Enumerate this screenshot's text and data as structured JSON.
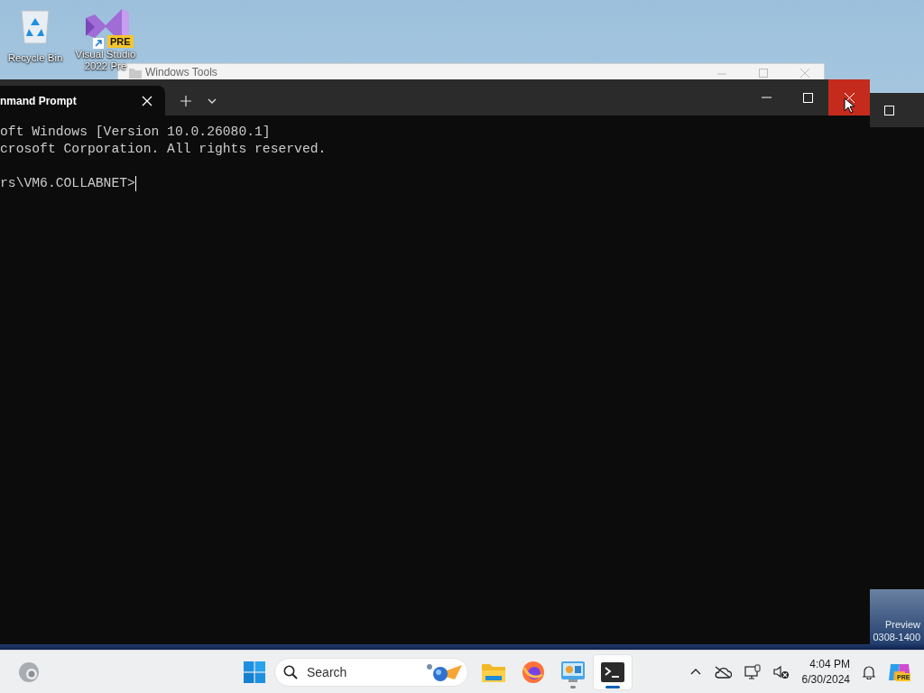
{
  "desktop_icons": [
    {
      "kind": "recycle",
      "label": "Recycle Bin"
    },
    {
      "kind": "vs",
      "label": "Visual Studio 2022 Pre",
      "badge": "PRE"
    }
  ],
  "background_window": {
    "title": "Windows Tools"
  },
  "terminal": {
    "tabs": [
      {
        "label": "nmand Prompt",
        "selected": true
      }
    ],
    "lines": [
      "oft Windows [Version 10.0.26080.1]",
      "crosoft Corporation. All rights reserved."
    ],
    "prompt": "rs\\VM6.COLLABNET>",
    "controls": [
      {
        "kind": "minimize",
        "hovered": false
      },
      {
        "kind": "maximize",
        "hovered": false
      },
      {
        "kind": "close",
        "hovered": true
      }
    ]
  },
  "desktop_watermark": [
    "Preview",
    "0308-1400"
  ],
  "taskbar": {
    "search": {
      "placeholder": "Search"
    },
    "apps": [
      {
        "kind": "files",
        "running": false,
        "selected": false
      },
      {
        "kind": "firefox",
        "running": false,
        "selected": false
      },
      {
        "kind": "control",
        "running": true,
        "selected": false
      },
      {
        "kind": "terminal",
        "running": true,
        "selected": true
      }
    ],
    "clock": {
      "time": "4:04 PM",
      "date": "6/30/2024"
    },
    "copilot_badge": "PRE"
  }
}
